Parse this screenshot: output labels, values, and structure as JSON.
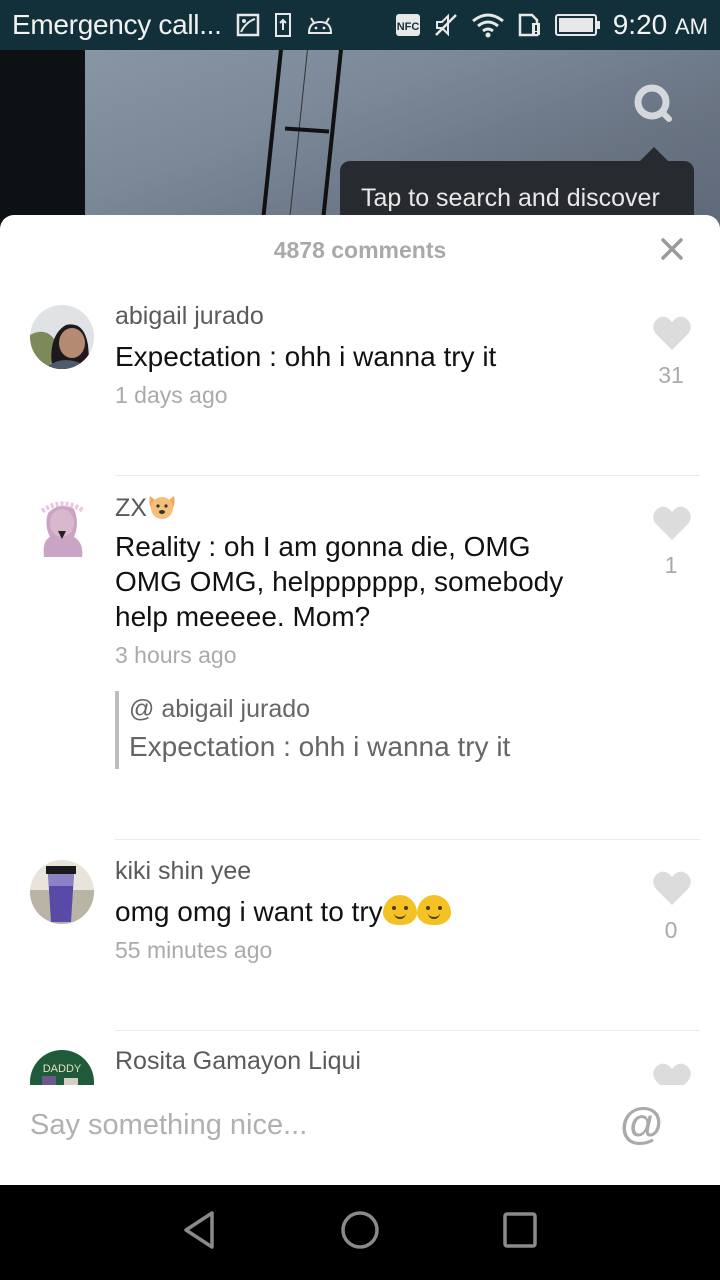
{
  "status_bar": {
    "title": "Emergency call...",
    "notification_icons": [
      "image-icon",
      "upload-icon",
      "android-icon"
    ],
    "system_icons": [
      "nfc-icon",
      "mute-icon",
      "wifi-icon",
      "sim-alert-icon",
      "battery-icon"
    ],
    "time": "9:20",
    "ampm": "AM"
  },
  "overlay": {
    "search_icon": "search-icon",
    "tooltip": "Tap to search and discover"
  },
  "sheet": {
    "count_label": "4878 comments",
    "close_icon": "close-icon",
    "comments": [
      {
        "author": "abigail jurado",
        "text": "Expectation : ohh i wanna try it",
        "time": "1 days ago",
        "likes": "31"
      },
      {
        "author": "ZX",
        "author_emoji": "dog-face",
        "text": "Reality : oh I am gonna die, OMG OMG OMG, helppppppp, somebody help meeeee. Mom?",
        "time": "3 hours ago",
        "likes": "1",
        "reply_to": {
          "author": "@ abigail jurado",
          "text": "Expectation : ohh i wanna try it"
        }
      },
      {
        "author": "kiki shin yee",
        "text": "omg omg i want to try",
        "text_emojis": [
          "smiling-face",
          "smiling-face"
        ],
        "time": "55 minutes ago",
        "likes": "0"
      },
      {
        "author": "Rosita Gamayon Liqui"
      }
    ]
  },
  "input": {
    "placeholder": "Say something nice...",
    "value": "",
    "mention_label": "@"
  },
  "colors": {
    "status_bar_bg": "#12303a",
    "muted_text": "#aaaaaa",
    "heart": "#dcdcdc",
    "tooltip_bg": "#272b30"
  }
}
